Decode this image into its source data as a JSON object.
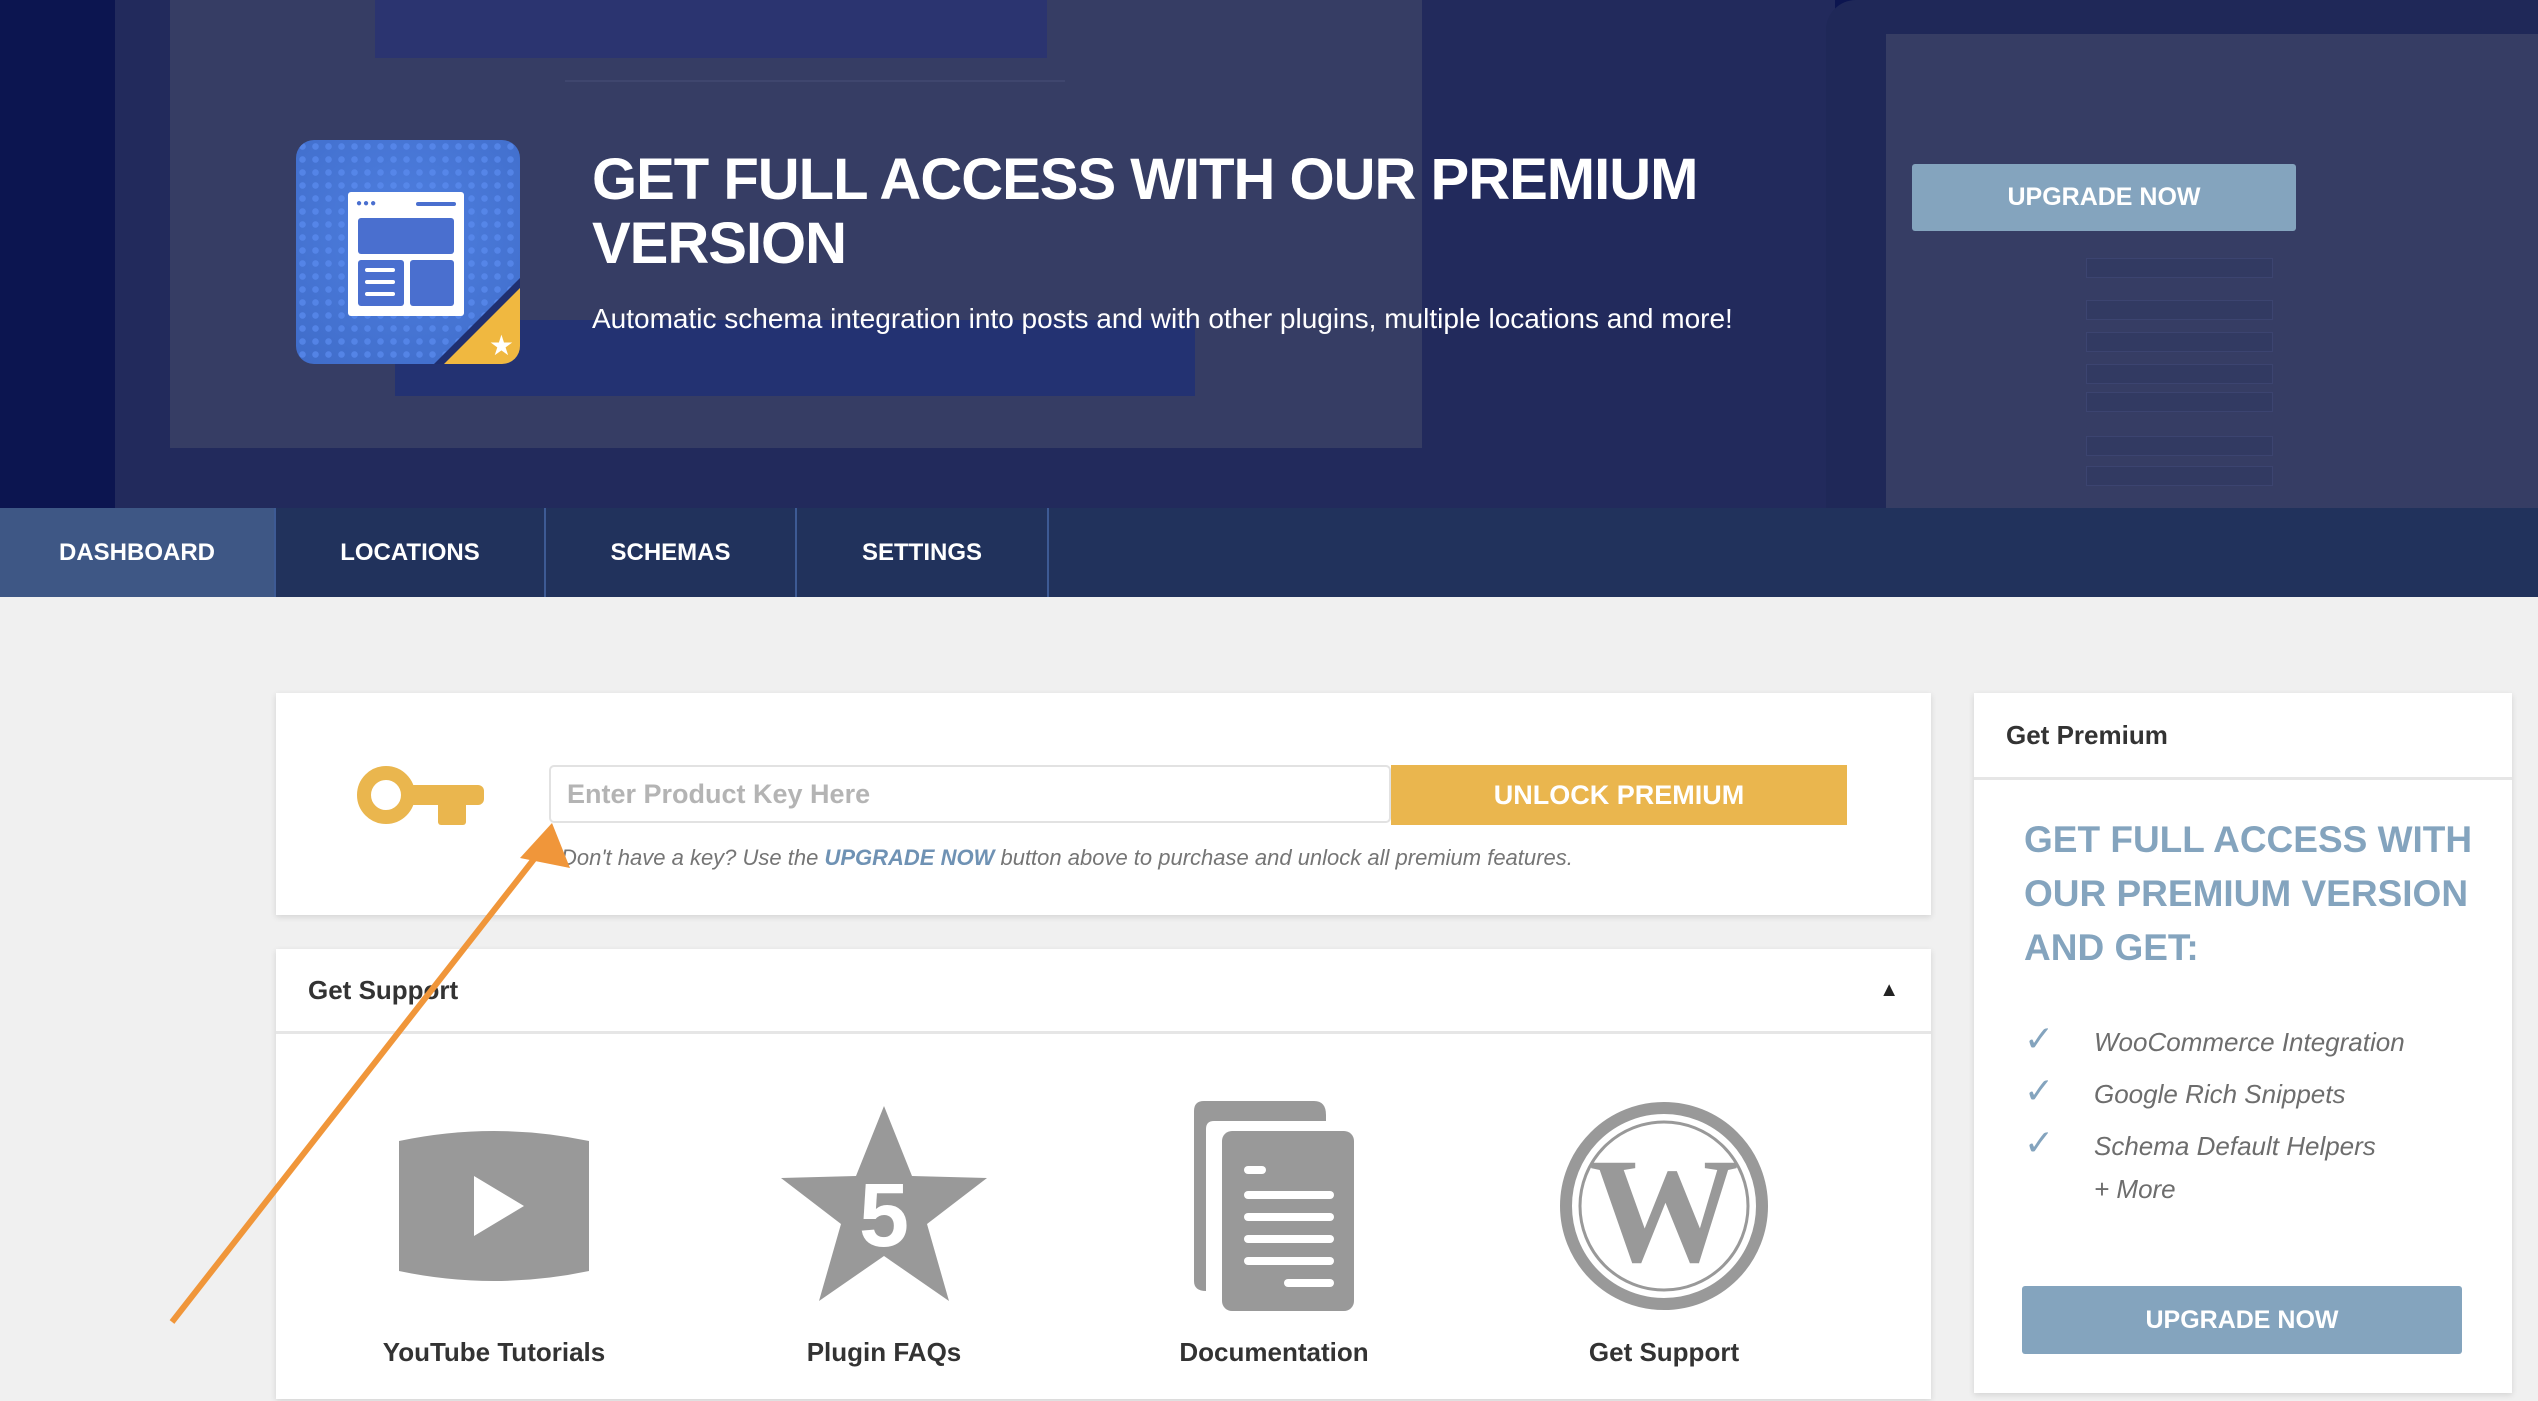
{
  "hero": {
    "title": "GET FULL ACCESS WITH OUR PREMIUM VERSION",
    "subtitle": "Automatic schema integration into posts and with other plugins, multiple locations and more!",
    "upgrade_button": "UPGRADE NOW",
    "icon": "schema-plugin-logo-icon"
  },
  "nav": {
    "tabs": [
      {
        "label": "DASHBOARD",
        "active": true
      },
      {
        "label": "LOCATIONS"
      },
      {
        "label": "SCHEMAS"
      },
      {
        "label": "SETTINGS"
      }
    ]
  },
  "license": {
    "key_icon": "key-icon",
    "input_placeholder": "Enter Product Key Here",
    "input_value": "",
    "unlock_button": "UNLOCK PREMIUM",
    "note_prefix": "Don't have a key? Use the ",
    "note_link": "UPGRADE NOW",
    "note_suffix": " button above to purchase and unlock all premium features."
  },
  "support": {
    "title": "Get Support",
    "toggle": "▲",
    "items": [
      {
        "label": "YouTube Tutorials",
        "icon": "youtube-icon"
      },
      {
        "label": "Plugin FAQs",
        "icon": "star-5-icon"
      },
      {
        "label": "Documentation",
        "icon": "document-icon"
      },
      {
        "label": "Get Support",
        "icon": "wordpress-icon"
      }
    ]
  },
  "premium": {
    "header": "Get Premium",
    "title": "GET FULL ACCESS WITH OUR PREMIUM VERSION AND GET:",
    "features": [
      {
        "label": "WooCommerce Integration",
        "checked": true
      },
      {
        "label": "Google Rich Snippets",
        "checked": true
      },
      {
        "label": "Schema Default Helpers",
        "checked": true
      },
      {
        "label": "+ More",
        "checked": false
      }
    ],
    "upgrade_button": "UPGRADE NOW"
  },
  "colors": {
    "hero_bg": "#0c1550",
    "nav_bg": "#21325c",
    "nav_active": "#3e5785",
    "accent_blue": "#84a4be",
    "accent_gold": "#eab64e",
    "annotation_arrow": "#f0963a"
  }
}
